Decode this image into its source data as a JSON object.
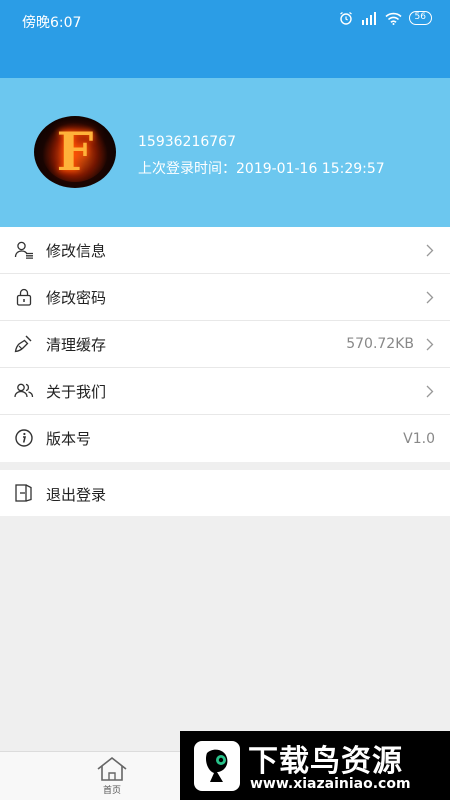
{
  "status": {
    "time": "傍晚6:07",
    "battery": "56"
  },
  "profile": {
    "phone": "15936216767",
    "last_login": "上次登录时间：2019-01-16 15:29:57"
  },
  "menu": [
    {
      "label": "修改信息",
      "icon": "user-edit-icon",
      "value": "",
      "arrow": true
    },
    {
      "label": "修改密码",
      "icon": "lock-icon",
      "value": "",
      "arrow": true
    },
    {
      "label": "清理缓存",
      "icon": "broom-icon",
      "value": "570.72KB",
      "arrow": true
    },
    {
      "label": "关于我们",
      "icon": "users-icon",
      "value": "",
      "arrow": true
    },
    {
      "label": "版本号",
      "icon": "info-icon",
      "value": "V1.0",
      "arrow": false
    }
  ],
  "logout": {
    "label": "退出登录",
    "icon": "logout-icon"
  },
  "tabbar": {
    "home_label": "首页"
  },
  "watermark": {
    "title": "下载鸟资源",
    "url": "www.xiazainiao.com"
  },
  "colors": {
    "header": "#2b9de6",
    "profile_bg": "#6cc7ef",
    "page_bg": "#efefef"
  }
}
